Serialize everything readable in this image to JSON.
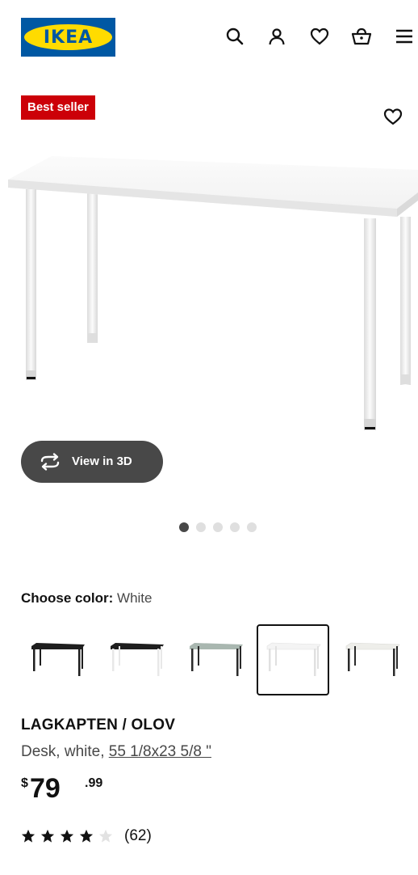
{
  "header": {
    "logo_text": "IKEA",
    "icons": [
      "search-icon",
      "user-icon",
      "heart-icon",
      "cart-icon",
      "menu-icon"
    ]
  },
  "badge": {
    "label": "Best seller"
  },
  "view3d": {
    "label": "View in 3D"
  },
  "carousel": {
    "total": 5,
    "active": 1
  },
  "color": {
    "label": "Choose color:",
    "value": "White"
  },
  "swatches": [
    {
      "top": "#1e1e1e",
      "legs": "#1e1e1e"
    },
    {
      "top": "#1e1e1e",
      "legs": "#eeeeee"
    },
    {
      "top": "#a9b7b0",
      "legs": "#2a2a2a"
    },
    {
      "top": "#f4f4f4",
      "legs": "#e6e6e6"
    },
    {
      "top": "#eeeeea",
      "legs": "#2a2a2a"
    }
  ],
  "selected_swatch": 4,
  "product": {
    "name": "LAGKAPTEN / OLOV",
    "desc_prefix": "Desk, white, ",
    "size": "55 1/8x23 5/8 \""
  },
  "price": {
    "currency": "$",
    "integer": "79",
    "decimal": ".99"
  },
  "rating": {
    "stars": 4,
    "max": 5,
    "count": "(62)"
  },
  "colors": {
    "badge": "#cc0008",
    "brand_blue": "#0058a3",
    "brand_yellow": "#ffdb00",
    "pill": "#484848"
  }
}
